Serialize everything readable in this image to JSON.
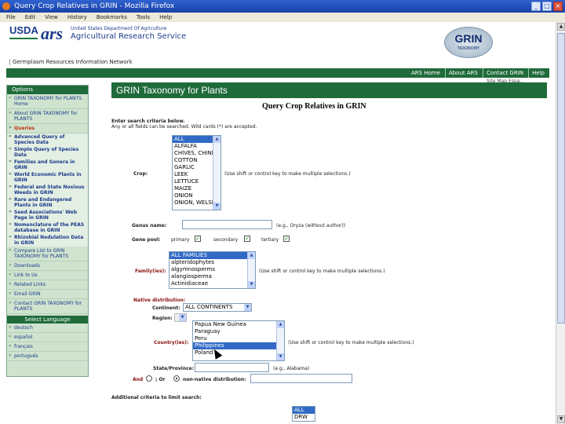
{
  "window": {
    "title": "Query Crop Relatives in GRIN - Mozilla Firefox",
    "buttons": [
      "_",
      "□",
      "×"
    ]
  },
  "menu": [
    "File",
    "Edit",
    "View",
    "History",
    "Bookmarks",
    "Tools",
    "Help"
  ],
  "header": {
    "usda": "USDA",
    "ars": "ars",
    "agency_small": "United States Department Of Agriculture",
    "agency_big": "Agricultural Research Service",
    "grin_logo": "GRIN",
    "grin_logo_sub": "TAXONOMY",
    "network": "Germplasm Resources Information Network"
  },
  "toplinks": [
    "ARS Home",
    "About ARS",
    "Contact GRIN",
    "Help"
  ],
  "sitemap": "Site Map  Espa...",
  "sidebar": {
    "options_heading": "Options",
    "items": [
      "GRIN TAXONOMY for PLANTS Home",
      "About GRIN TAXONOMY for PLANTS"
    ],
    "queries_label": "Queries",
    "sub_items": [
      "Advanced Query of Species Data",
      "Simple Query of Species Data",
      "Families and Genera in GRIN",
      "World Economic Plants in GRIN",
      "Federal and State Noxious Weeds in GRIN",
      "Rare and Endangered Plants in GRIN",
      "Seed Associations' Web Page in GRIN",
      "Nomenclature of the PEAS database in GRIN",
      "Rhizobial Nodulation Data in GRIN"
    ],
    "more_items": [
      "Compare List to GRIN TAXONOMY for PLANTS",
      "Downloads",
      "Link to Us",
      "Related Links",
      "Email GRIN",
      "Contact GRIN TAXONOMY for PLANTS"
    ],
    "language_heading": "Select Language",
    "languages": [
      "deutsch",
      "español",
      "français",
      "português"
    ]
  },
  "main": {
    "title": "GRIN Taxonomy for Plants",
    "heading": "Query Crop Relatives in GRIN",
    "instructions1": "Enter search criteria below.",
    "instructions2": "Any or all fields can be searched.   Wild cards (*) are accepted.",
    "crop_label": "Crop:",
    "crop_options": [
      "ALL",
      "ALFALFA",
      "CHIVES, CHINESE",
      "COTTON",
      "GARLIC",
      "LEEK",
      "LETTUCE",
      "MAIZE",
      "ONION",
      "ONION, WELSH"
    ],
    "crop_note": "(Use shift or control key to make multiple selections.)",
    "genus_label": "Genus name:",
    "genus_note": "(e.g., Oryza (without author))",
    "gene_pool_label": "Gene pool:",
    "gene_pool_primary": "primary",
    "gene_pool_secondary": "secondary",
    "gene_pool_tertiary": "tertiary",
    "family_label": "Family(ies):",
    "family_options": [
      "ALL FAMILIES",
      "alpteridophytes",
      "algymnosperms",
      "alangiosperma",
      "Actinidiaceae"
    ],
    "family_note": "(Use shift or control key to make multiple selections.)",
    "native_label": "Native distribution:",
    "continent_label": "Continent:",
    "continent_value": "ALL CONTINENTS",
    "region_label": "Region:",
    "country_label": "Country(ies):",
    "country_options": [
      "Papua New Guinea",
      "Paraguay",
      "Peru",
      "Philippines",
      "Poland"
    ],
    "country_note": "(Use shift or control key to make multiple selections.)",
    "state_label": "State/Province:",
    "state_note": "(e.g., Alabama)",
    "and_label": "And",
    "or_label": "; Or",
    "non_native_label": "non-native distribution:",
    "additional_label": "Additional criteria to limit search:",
    "bottom_options": [
      "ALL",
      "DRW"
    ]
  },
  "colors": {
    "green_bar": "#1f6b3a",
    "selection_blue": "#316ac5",
    "sidebar_bg": "#cfe3cf",
    "link_blue": "#1a3a8a"
  }
}
